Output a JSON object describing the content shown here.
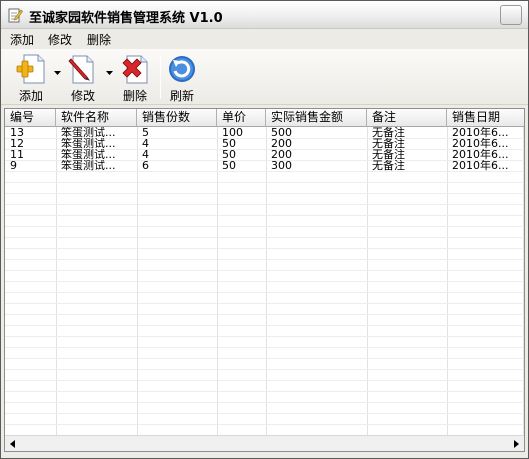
{
  "window": {
    "title": "至诚家园软件销售管理系统 V1.0"
  },
  "menu": {
    "items": [
      "添加",
      "修改",
      "删除"
    ]
  },
  "toolbar": {
    "add_label": "添加",
    "edit_label": "修改",
    "delete_label": "删除",
    "refresh_label": "刷新"
  },
  "table": {
    "columns": [
      "编号",
      "软件名称",
      "销售份数",
      "单价",
      "实际销售金额",
      "备注",
      "销售日期"
    ],
    "rows": [
      [
        "13",
        "笨蛋测试...",
        "5",
        "100",
        "500",
        "无备注",
        "2010年6..."
      ],
      [
        "12",
        "笨蛋测试...",
        "4",
        "50",
        "200",
        "无备注",
        "2010年6..."
      ],
      [
        "11",
        "笨蛋测试...",
        "4",
        "50",
        "200",
        "无备注",
        "2010年6..."
      ],
      [
        "9",
        "笨蛋测试...",
        "6",
        "50",
        "300",
        "无备注",
        "2010年6..."
      ]
    ]
  },
  "colors": {
    "accent_blue": "#2b6cc4",
    "delete_red": "#d8262a",
    "add_gold": "#f2b319"
  }
}
